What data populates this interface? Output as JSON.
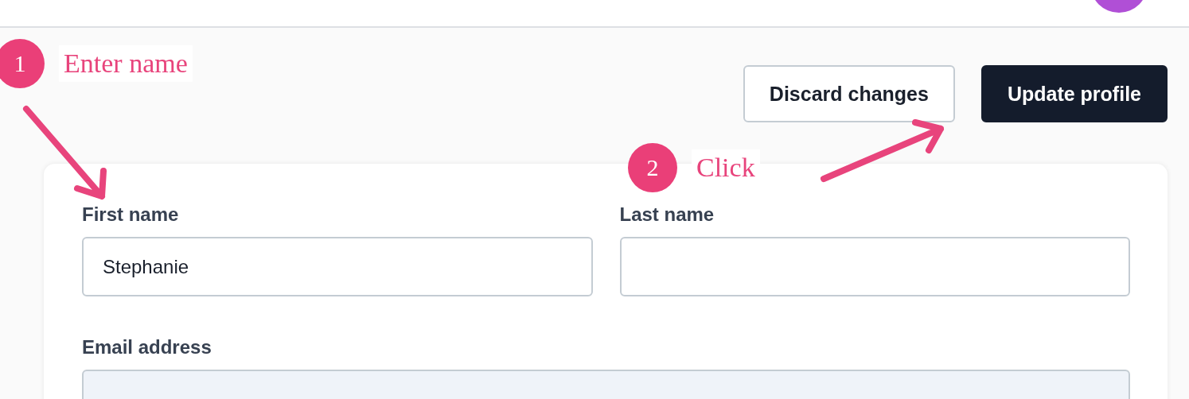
{
  "actions": [
    {
      "label": "Discard changes",
      "kind": "secondary"
    },
    {
      "label": "Update profile",
      "kind": "primary"
    }
  ],
  "form": {
    "fields": [
      {
        "label": "First name",
        "value": "Stephanie",
        "disabled": false,
        "kind": "half"
      },
      {
        "label": "Last name",
        "disabled": false,
        "kind": "half"
      },
      {
        "label": "Email address",
        "disabled": true,
        "kind": "full"
      }
    ]
  },
  "annotations": [
    {
      "number": "1",
      "text": "Enter name"
    },
    {
      "number": "2",
      "text": "Click"
    }
  ]
}
